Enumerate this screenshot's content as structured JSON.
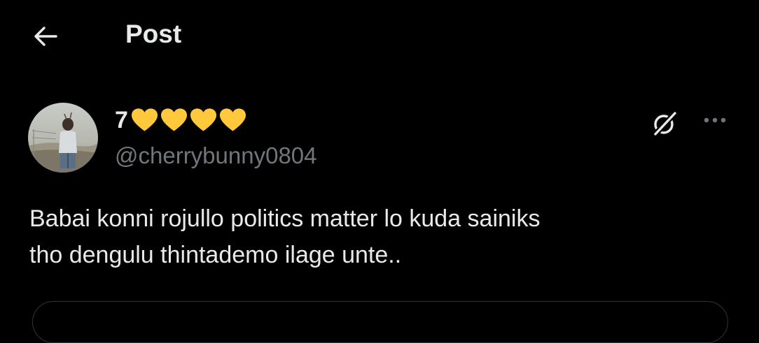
{
  "header": {
    "back_icon": "arrow-left-icon",
    "title": "Post"
  },
  "post": {
    "author": {
      "display_name_prefix": "7",
      "display_name_emoji": [
        "yellow-heart",
        "yellow-heart",
        "yellow-heart",
        "yellow-heart"
      ],
      "handle": "@cherrybunny0804",
      "avatar": "profile-photo"
    },
    "actions": {
      "grok_icon": "grok-icon",
      "more_icon": "more-horizontal-icon"
    },
    "text": "Babai konni rojullo politics matter lo kuda sainiks\ntho dengulu thintademo ilage unte.."
  },
  "colors": {
    "background": "#000000",
    "primary_text": "#e7e9ea",
    "secondary_text": "#71767b",
    "heart": "#ffc83d",
    "border": "#2f3336"
  }
}
